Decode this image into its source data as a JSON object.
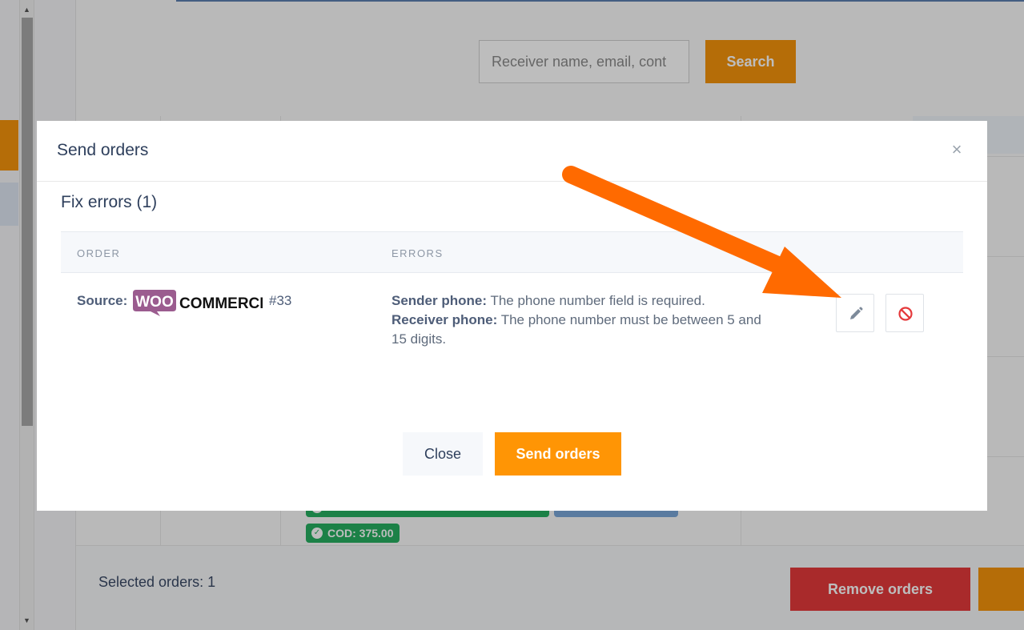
{
  "background": {
    "search": {
      "placeholder": "Receiver name, email, cont",
      "button_label": "Search"
    },
    "badges": {
      "cod": "COD: 375.00"
    },
    "bottom_bar": {
      "selected_orders": "Selected orders: 1",
      "remove_button": "Remove orders"
    }
  },
  "modal": {
    "title": "Send orders",
    "close_glyph": "×",
    "fix_errors_title": "Fix errors (1)",
    "table": {
      "headers": {
        "order": "ORDER",
        "errors": "ERRORS"
      },
      "rows": [
        {
          "source_label": "Source:",
          "source_logo": "woocommerce-logo",
          "order_number": "#33",
          "errors": [
            {
              "field": "Sender phone:",
              "message": "The phone number field is required."
            },
            {
              "field": "Receiver phone:",
              "message": "The phone number must be between 5 and 15 digits."
            }
          ],
          "actions": [
            "pencil-icon",
            "ban-icon"
          ]
        }
      ]
    },
    "footer": {
      "close_button": "Close",
      "send_button": "Send orders"
    }
  },
  "colors": {
    "accent_orange": "#ff9505",
    "danger_red": "#e5393b",
    "success_green": "#27ae60",
    "text_dark": "#2e3f5c",
    "arrow_orange": "#ff6a00",
    "woo_purple": "#9b5c8f"
  }
}
